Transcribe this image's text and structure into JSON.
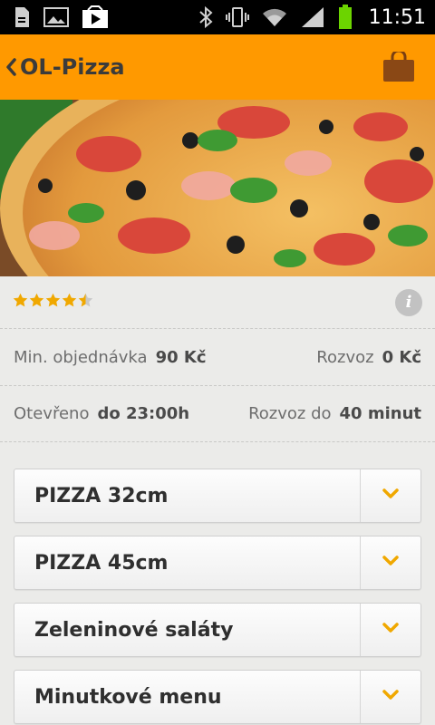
{
  "status_bar": {
    "time": "11:51",
    "icons": [
      "sd-card-icon",
      "image-icon",
      "play-store-icon",
      "bluetooth-icon",
      "vibrate-icon",
      "wifi-icon",
      "signal-icon",
      "battery-icon"
    ]
  },
  "app_bar": {
    "title": "OL-Pizza",
    "back_icon": "chevron-left-icon",
    "cart_icon": "shopping-bag-icon",
    "color": "#ff9900"
  },
  "restaurant": {
    "rating": 4.5,
    "rating_max": 5,
    "star_color": "#f0a800",
    "min_order_label": "Min. objednávka",
    "min_order_value": "90 Kč",
    "delivery_label": "Rozvoz",
    "delivery_value": "0 Kč",
    "open_label": "Otevřeno",
    "open_value": "do 23:00h",
    "delivery_time_label": "Rozvoz do",
    "delivery_time_value": "40 minut"
  },
  "categories": [
    {
      "label": "PIZZA 32cm"
    },
    {
      "label": "PIZZA 45cm"
    },
    {
      "label": "Zeleninové saláty"
    },
    {
      "label": "Minutkové menu"
    }
  ],
  "accent": "#f0a800"
}
